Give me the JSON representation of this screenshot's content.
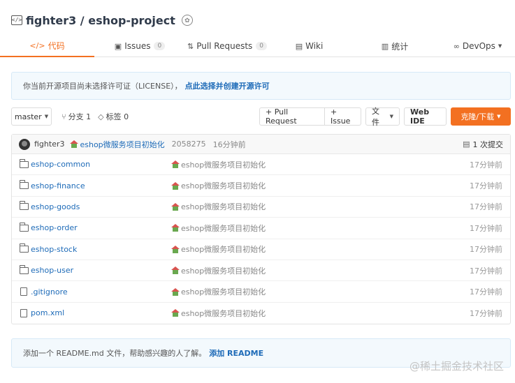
{
  "repo": {
    "title": "fighter3 / eshop-project",
    "icon": "code-file-icon",
    "badge_icon": "award-badge-icon"
  },
  "tabs": [
    {
      "id": "code",
      "label": "代码",
      "icon": "</>",
      "count": "",
      "active": true
    },
    {
      "id": "issues",
      "label": "Issues",
      "icon": "▣",
      "count": "0",
      "active": false
    },
    {
      "id": "pulls",
      "label": "Pull Requests",
      "icon": "⇅",
      "count": "0",
      "active": false
    },
    {
      "id": "wiki",
      "label": "Wiki",
      "icon": "▤",
      "count": "",
      "active": false
    },
    {
      "id": "stats",
      "label": "统计",
      "icon": "▥",
      "count": "",
      "active": false
    },
    {
      "id": "devops",
      "label": "DevOps",
      "icon": "∞",
      "count": "",
      "active": false
    }
  ],
  "license_notice": {
    "text": "你当前开源项目尚未选择许可证（LICENSE），",
    "link": "点此选择并创建开源许可"
  },
  "toolbar": {
    "branch": "master",
    "branches_label": "分支 1",
    "tags_label": "标签 0",
    "pull_request": "+ Pull Request",
    "issue": "+ Issue",
    "files": "文件",
    "web_ide": "Web IDE",
    "clone": "克隆/下载"
  },
  "commit": {
    "author": "fighter3",
    "message": "eshop微服务项目初始化",
    "hash": "2058275",
    "time": "16分钟前",
    "commits": "1 次提交"
  },
  "files": [
    {
      "name": "eshop-common",
      "type": "folder",
      "message": "eshop微服务项目初始化",
      "time": "17分钟前"
    },
    {
      "name": "eshop-finance",
      "type": "folder",
      "message": "eshop微服务项目初始化",
      "time": "17分钟前"
    },
    {
      "name": "eshop-goods",
      "type": "folder",
      "message": "eshop微服务项目初始化",
      "time": "17分钟前"
    },
    {
      "name": "eshop-order",
      "type": "folder",
      "message": "eshop微服务项目初始化",
      "time": "17分钟前"
    },
    {
      "name": "eshop-stock",
      "type": "folder",
      "message": "eshop微服务项目初始化",
      "time": "17分钟前"
    },
    {
      "name": "eshop-user",
      "type": "folder",
      "message": "eshop微服务项目初始化",
      "time": "17分钟前"
    },
    {
      "name": ".gitignore",
      "type": "file",
      "message": "eshop微服务项目初始化",
      "time": "17分钟前"
    },
    {
      "name": "pom.xml",
      "type": "file",
      "message": "eshop微服务项目初始化",
      "time": "17分钟前"
    }
  ],
  "readme_notice": {
    "text": "添加一个 README.md 文件，帮助感兴趣的人了解。",
    "link": "添加 README"
  },
  "watermark": "@稀土掘金技术社区",
  "colors": {
    "accent": "#f37021",
    "link": "#1e6bb8",
    "notice_bg": "#f3f9fd"
  }
}
